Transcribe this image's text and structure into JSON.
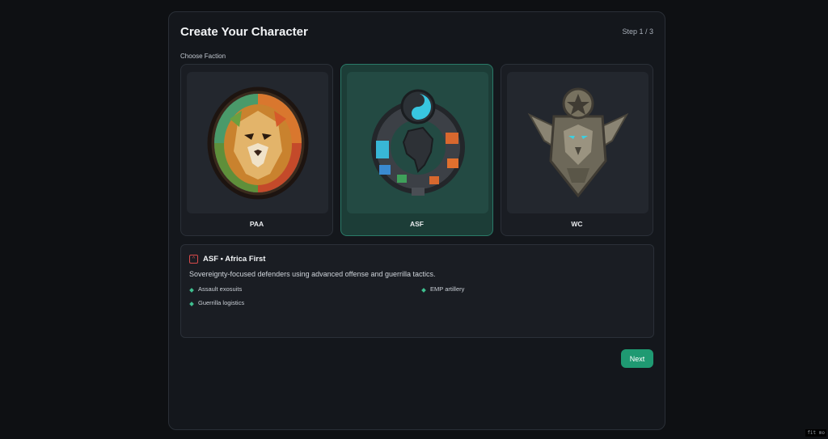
{
  "header": {
    "title": "Create Your Character",
    "step": "Step 1 / 3"
  },
  "faction_section": {
    "label": "Choose Faction",
    "selected": "ASF",
    "cards": [
      {
        "name": "PAA",
        "emblem": "lion-emblem-icon"
      },
      {
        "name": "ASF",
        "emblem": "africa-ring-emblem-icon"
      },
      {
        "name": "WC",
        "emblem": "eagle-shield-emblem-icon"
      }
    ]
  },
  "info": {
    "title": "ASF • Africa First",
    "description": "Sovereignty-focused defenders using advanced offense and guerrilla tactics.",
    "traits": [
      "Assault exosuits",
      "EMP artillery",
      "Guerrilla logistics"
    ]
  },
  "actions": {
    "next_label": "Next"
  },
  "corner_text": "fit mo",
  "colors": {
    "accent": "#1f9a72",
    "selected_card": "#1c3d37",
    "background": "#0e1013",
    "panel": "#14171c"
  }
}
